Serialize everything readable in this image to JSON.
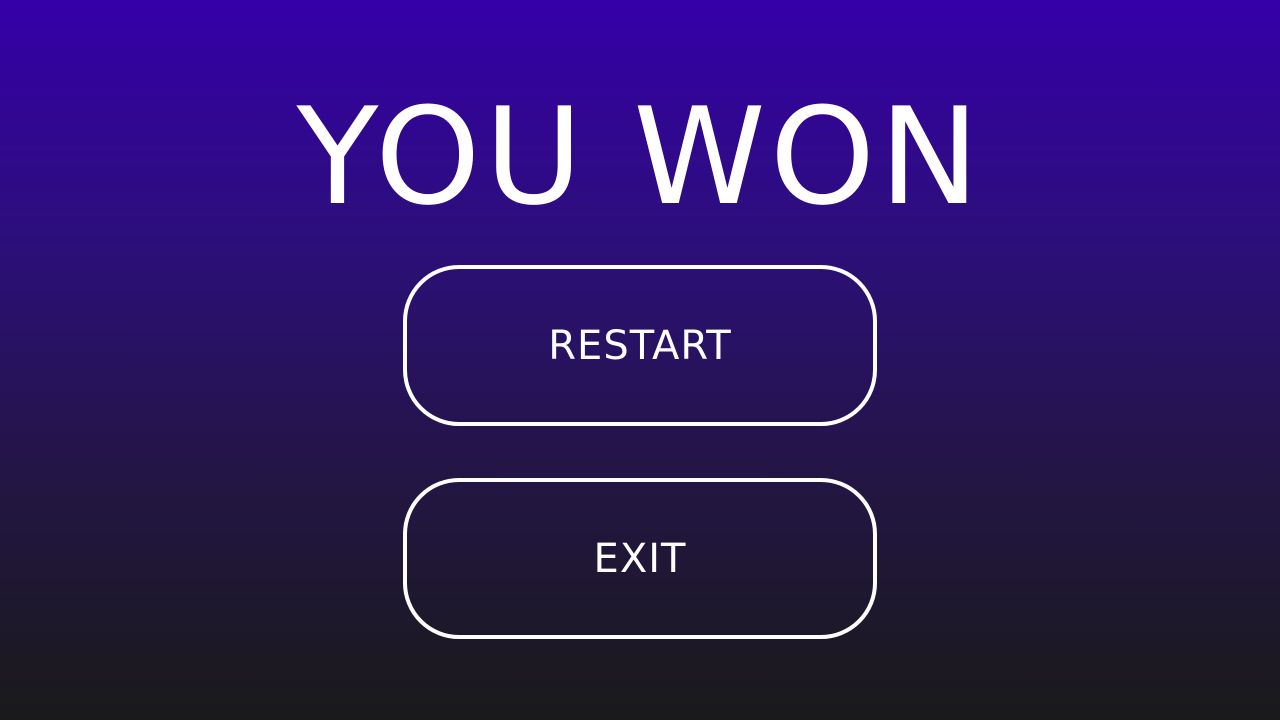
{
  "screen": {
    "title": "YOU WON"
  },
  "menu": {
    "restart_label": "RESTART",
    "exit_label": "EXIT"
  },
  "colors": {
    "background_top": "#3500a8",
    "background_bottom": "#1a1a1a",
    "text": "#ffffff",
    "button_border": "#ffffff"
  }
}
